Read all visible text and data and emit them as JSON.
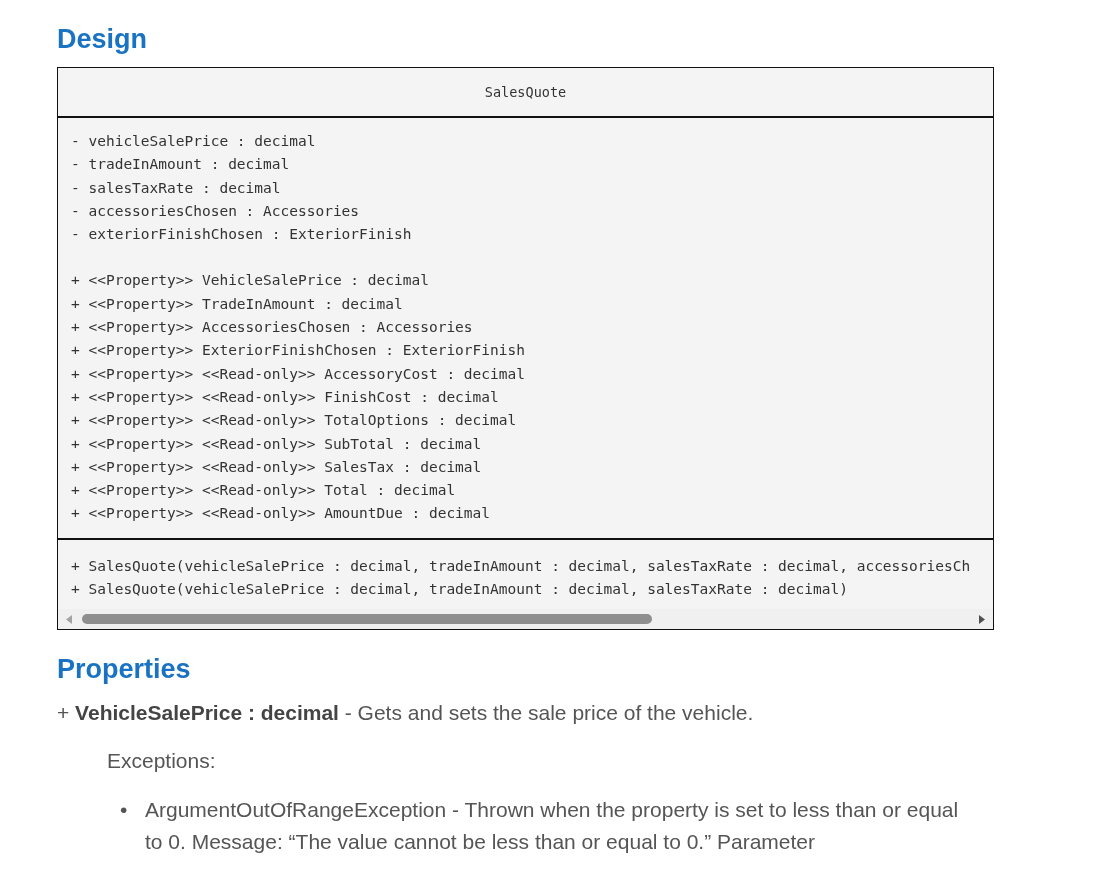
{
  "design_heading": "Design",
  "class_diagram": {
    "name": "SalesQuote",
    "attributes": [
      "- vehicleSalePrice : decimal",
      "- tradeInAmount : decimal",
      "- salesTaxRate : decimal",
      "- accessoriesChosen : Accessories",
      "- exteriorFinishChosen : ExteriorFinish"
    ],
    "properties": [
      "+ <<Property>> VehicleSalePrice : decimal",
      "+ <<Property>> TradeInAmount : decimal",
      "+ <<Property>> AccessoriesChosen : Accessories",
      "+ <<Property>> ExteriorFinishChosen : ExteriorFinish",
      "+ <<Property>> <<Read-only>> AccessoryCost : decimal",
      "+ <<Property>> <<Read-only>> FinishCost : decimal",
      "+ <<Property>> <<Read-only>> TotalOptions : decimal",
      "+ <<Property>> <<Read-only>> SubTotal : decimal",
      "+ <<Property>> <<Read-only>> SalesTax : decimal",
      "+ <<Property>> <<Read-only>> Total : decimal",
      "+ <<Property>> <<Read-only>> AmountDue : decimal"
    ],
    "methods": [
      "+ SalesQuote(vehicleSalePrice : decimal, tradeInAmount : decimal, salesTaxRate : decimal, accessoriesCh",
      "+ SalesQuote(vehicleSalePrice : decimal, tradeInAmount : decimal, salesTaxRate : decimal)"
    ]
  },
  "properties_heading": "Properties",
  "property_description": "+ **VehicleSalePrice : decimal** - Gets and sets the sale price of the vehicle.",
  "exceptions_label": "Exceptions:",
  "exceptions": [
    {
      "marker": "•",
      "text": "ArgumentOutOfRangeException - Thrown when the property is set to less than or equal to 0. Message: “The value cannot be less than or equal to 0.” Parameter"
    }
  ]
}
